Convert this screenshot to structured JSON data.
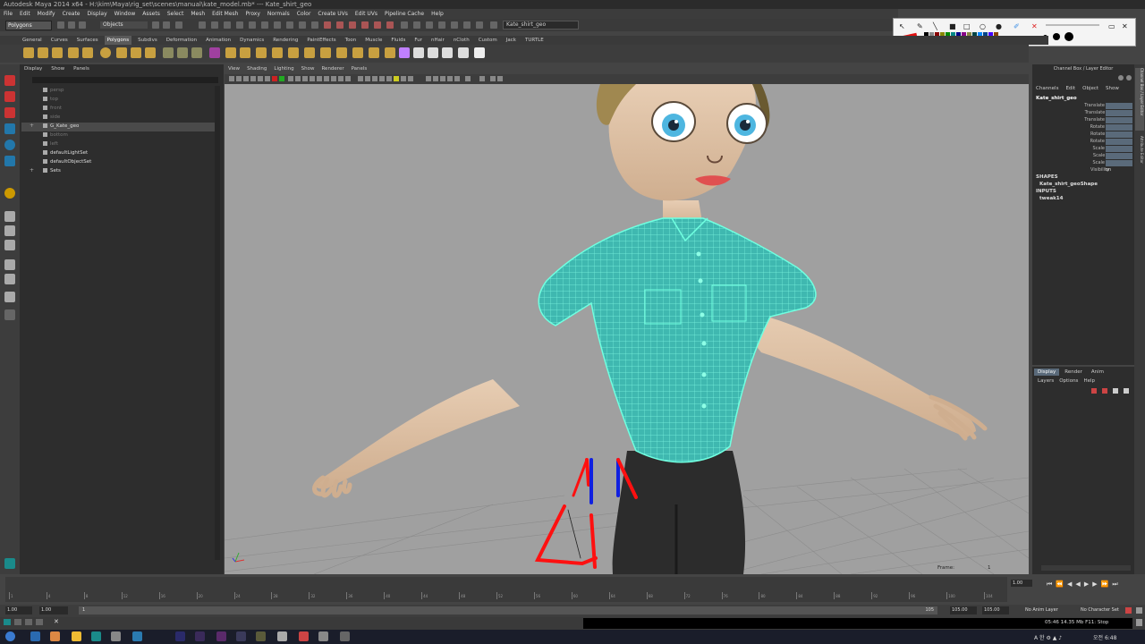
{
  "title_bar": "Autodesk Maya 2014 x64 - H:\\kim\\Maya\\rig_set\\scenes\\manual\\kate_model.mb* --- Kate_shirt_geo",
  "menu": [
    "File",
    "Edit",
    "Modify",
    "Create",
    "Display",
    "Window",
    "Assets",
    "Select",
    "Mesh",
    "Edit Mesh",
    "Proxy",
    "Normals",
    "Color",
    "Create UVs",
    "Edit UVs",
    "Pipeline Cache",
    "Help"
  ],
  "status_line": {
    "mode": "Polygons",
    "selection_mode": "Objects",
    "name_field": "Kate_shirt_geo"
  },
  "shelf_tabs": [
    "General",
    "Curves",
    "Surfaces",
    "Polygons",
    "Subdivs",
    "Deformation",
    "Animation",
    "Dynamics",
    "Rendering",
    "PaintEffects",
    "Toon",
    "Muscle",
    "Fluids",
    "Fur",
    "nHair",
    "nCloth",
    "Custom",
    "Jack",
    "TURTLE"
  ],
  "active_shelf": "Polygons",
  "outliner": {
    "menu": [
      "Display",
      "Show",
      "Panels"
    ],
    "items": [
      {
        "label": "persp",
        "dim": true
      },
      {
        "label": "top",
        "dim": true
      },
      {
        "label": "front",
        "dim": true
      },
      {
        "label": "side",
        "dim": true
      },
      {
        "label": "G_Kate_geo",
        "dim": false
      },
      {
        "label": "bottom",
        "dim": true
      },
      {
        "label": "left",
        "dim": true
      },
      {
        "label": "defaultLightSet",
        "dim": false
      },
      {
        "label": "defaultObjectSet",
        "dim": false
      },
      {
        "label": "Sets",
        "dim": false
      }
    ]
  },
  "viewport": {
    "menu": [
      "View",
      "Shading",
      "Lighting",
      "Show",
      "Renderer",
      "Panels"
    ],
    "frame_label": "Frame:",
    "frame_value": "1"
  },
  "channel_box": {
    "title": "Channel Box / Layer Editor",
    "menu": [
      "Channels",
      "Edit",
      "Object",
      "Show"
    ],
    "object": "Kate_shirt_geo",
    "attributes": [
      "Translate X",
      "Translate Y",
      "Translate Z",
      "Rotate X",
      "Rotate Y",
      "Rotate Z",
      "Scale X",
      "Scale Y",
      "Scale Z",
      "Visibility"
    ],
    "visibility_value": "on",
    "shapes_header": "SHAPES",
    "shape": "Kate_shirt_geoShape",
    "inputs_header": "INPUTS",
    "input": "tweak14"
  },
  "side_tabs": [
    "Channel Box / Layer Editor",
    "Attribute Editor"
  ],
  "layer_editor": {
    "tabs": [
      "Display",
      "Render",
      "Anim"
    ],
    "menu": [
      "Layers",
      "Options",
      "Help"
    ]
  },
  "time_slider": {
    "ticks": [
      "1",
      "4",
      "8",
      "12",
      "16",
      "20",
      "24",
      "28",
      "32",
      "36",
      "40",
      "44",
      "48",
      "52",
      "56",
      "60",
      "64",
      "68",
      "72",
      "76",
      "80",
      "84",
      "88",
      "92",
      "96",
      "100",
      "104"
    ],
    "current": "1.00"
  },
  "range": {
    "start": "1.00",
    "start2": "1.00",
    "slider_label": "1",
    "end_slider": "105",
    "end": "105.00",
    "end2": "105.00",
    "anim_layer": "No Anim Layer",
    "char_set": "No Character Set"
  },
  "cmd": {
    "status": "05:46  14.35 Mb  F11: Stop"
  },
  "taskbar": {
    "clock": "오전 6:48"
  },
  "colors": {
    "shirt": "#3fb8b0",
    "wire": "#70ffe0",
    "skin": "#e0c4a8",
    "annotation_red": "#ff1010",
    "annotation_blue": "#1020e0"
  }
}
